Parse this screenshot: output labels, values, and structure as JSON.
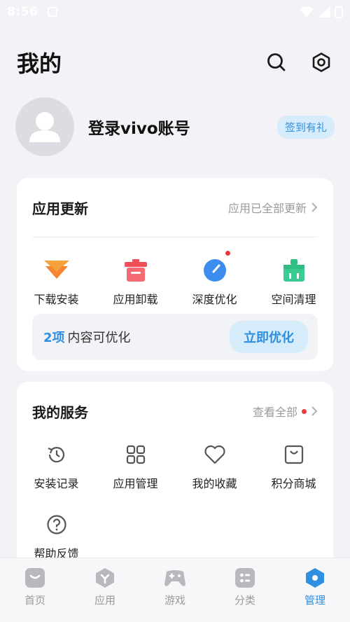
{
  "status_bar": {
    "time": "8:56"
  },
  "header": {
    "title": "我的",
    "search_icon": "search-icon",
    "settings_icon": "settings-icon"
  },
  "profile": {
    "login_text": "登录vivo账号",
    "checkin_badge": "签到有礼"
  },
  "updates_card": {
    "title": "应用更新",
    "status_link": "应用已全部更新",
    "items": [
      {
        "label": "下载安装",
        "icon": "download-icon",
        "color": "#f5862f"
      },
      {
        "label": "应用卸载",
        "icon": "uninstall-trash-icon",
        "color": "#f04f57"
      },
      {
        "label": "深度优化",
        "icon": "deep-optimize-icon",
        "color": "#3d8cf0",
        "has_dot": true
      },
      {
        "label": "空间清理",
        "icon": "space-clean-icon",
        "color": "#2fbf86"
      }
    ],
    "optimize": {
      "count": "2项",
      "text": "内容可优化",
      "button": "立即优化"
    }
  },
  "services_card": {
    "title": "我的服务",
    "link": "查看全部",
    "items": [
      {
        "label": "安装记录",
        "icon": "install-history-icon"
      },
      {
        "label": "应用管理",
        "icon": "app-manage-grid-icon"
      },
      {
        "label": "我的收藏",
        "icon": "heart-icon"
      },
      {
        "label": "积分商城",
        "icon": "points-mall-icon"
      },
      {
        "label": "帮助反馈",
        "icon": "help-question-icon"
      }
    ]
  },
  "tab_bar": {
    "tabs": [
      {
        "label": "首页",
        "icon": "home-icon",
        "active": false
      },
      {
        "label": "应用",
        "icon": "apps-icon",
        "active": false
      },
      {
        "label": "游戏",
        "icon": "gamepad-icon",
        "active": false
      },
      {
        "label": "分类",
        "icon": "category-icon",
        "active": false
      },
      {
        "label": "管理",
        "icon": "manage-hexagon-icon",
        "active": true
      }
    ]
  },
  "colors": {
    "accent": "#2f8fe0",
    "badge_bg": "#d7ecfb",
    "dot": "#e63b3b"
  }
}
